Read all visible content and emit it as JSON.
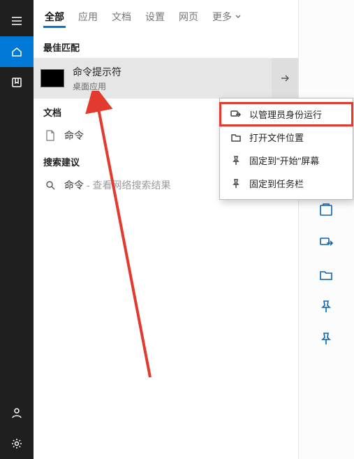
{
  "tabs": {
    "all": "全部",
    "apps": "应用",
    "docs": "文档",
    "settings": "设置",
    "web": "网页",
    "more": "更多"
  },
  "sections": {
    "best_match": "最佳匹配",
    "documents": "文档",
    "suggestions": "搜索建议"
  },
  "best": {
    "title": "命令提示符",
    "subtitle": "桌面应用"
  },
  "docs": {
    "item1": "命令"
  },
  "suggest": {
    "term": "命令",
    "hint": " - 查看网络搜索结果"
  },
  "context": {
    "run_admin": "以管理员身份运行",
    "open_location": "打开文件位置",
    "pin_start": "固定到\"开始\"屏幕",
    "pin_taskbar": "固定到任务栏"
  }
}
